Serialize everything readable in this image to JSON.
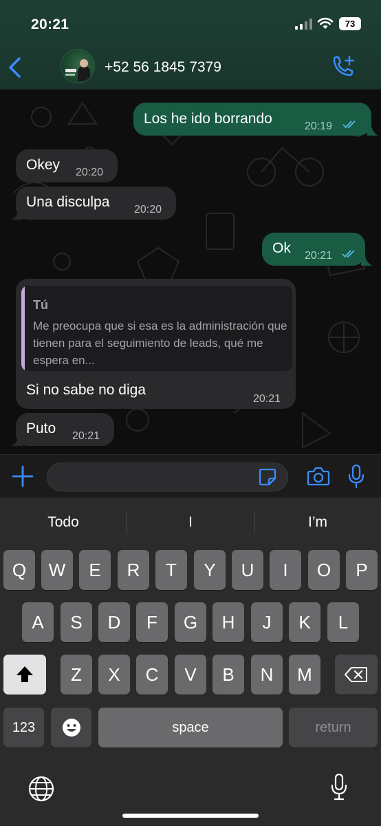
{
  "status": {
    "time": "20:21",
    "battery": "73"
  },
  "header": {
    "contact_name": "+52 56 1845 7379"
  },
  "messages": [
    {
      "direction": "out",
      "text": "Los he ido borrando",
      "time": "20:19",
      "read": true
    },
    {
      "direction": "in",
      "text": "Okey",
      "time": "20:20"
    },
    {
      "direction": "in",
      "text": "Una disculpa",
      "time": "20:20"
    },
    {
      "direction": "out",
      "text": "Ok",
      "time": "20:21",
      "read": true
    },
    {
      "direction": "in",
      "quote_author": "Tú",
      "quote_text": "Me preocupa que si esa es la administración que tienen para el seguimiento de leads, qué me espera en...",
      "text": "Si no sabe no diga",
      "time": "20:21"
    },
    {
      "direction": "in",
      "text": "Puto",
      "time": "20:21"
    }
  ],
  "input": {
    "value": "",
    "placeholder": ""
  },
  "keyboard": {
    "suggestions": [
      "Todo",
      "I",
      "I’m"
    ],
    "row1": [
      "Q",
      "W",
      "E",
      "R",
      "T",
      "Y",
      "U",
      "I",
      "O",
      "P"
    ],
    "row2": [
      "A",
      "S",
      "D",
      "F",
      "G",
      "H",
      "J",
      "K",
      "L"
    ],
    "row3": [
      "Z",
      "X",
      "C",
      "V",
      "B",
      "N",
      "M"
    ],
    "numbers_key": "123",
    "space_key": "space",
    "return_key": "return"
  },
  "colors": {
    "accent": "#3b8cff",
    "outgoing_bubble": "#195b43",
    "incoming_bubble": "#2a2a2c",
    "quote_bar": "#c7a8d8"
  },
  "icons": [
    "back-icon",
    "avatar",
    "call-add-icon",
    "plus-icon",
    "sticker-icon",
    "camera-icon",
    "microphone-icon",
    "shift-icon",
    "delete-icon",
    "emoji-icon",
    "globe-icon",
    "dictation-icon",
    "read-ticks-icon"
  ]
}
